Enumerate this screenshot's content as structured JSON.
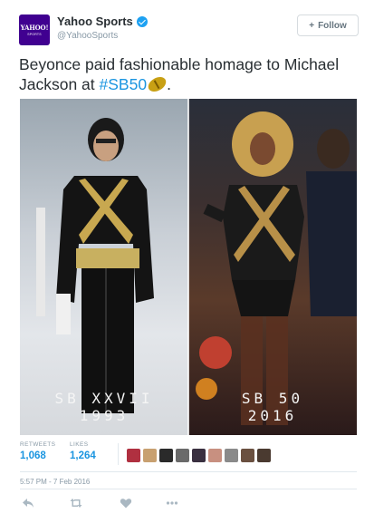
{
  "account": {
    "display_name": "Yahoo Sports",
    "handle": "@YahooSports",
    "avatar_logo": "YAHOO!",
    "avatar_sub": "SPORTS",
    "brand_color": "#400090",
    "verified_color": "#1da1f2"
  },
  "follow_button": {
    "label": "Follow",
    "icon": "add-user-icon"
  },
  "tweet": {
    "text_line1": "Beyonce paid fashionable homage to Michael",
    "text_line2_prefix": "Jackson at ",
    "hashtag": "#SB50",
    "text_suffix": ".",
    "emoji_icon": "football-icon",
    "hashtag_color": "#1b95e0"
  },
  "media": {
    "left_caption_line1": "SB XXVII",
    "left_caption_line2": "1993",
    "right_caption_line1": "SB 50",
    "right_caption_line2": "2016"
  },
  "stats": {
    "retweets_label": "RETWEETS",
    "retweets_value": "1,068",
    "likes_label": "LIKES",
    "likes_value": "1,264",
    "liker_avatar_colors": [
      "#b03040",
      "#c8a070",
      "#2a2a2a",
      "#6a6a6a",
      "#3a3040",
      "#c89080",
      "#8a8a8a",
      "#6a5040",
      "#4a3a30"
    ]
  },
  "timestamp": "5:57 PM - 7 Feb 2016",
  "actions": {
    "reply_icon": "reply-icon",
    "retweet_icon": "retweet-icon",
    "like_icon": "heart-icon",
    "more_icon": "more-icon"
  }
}
